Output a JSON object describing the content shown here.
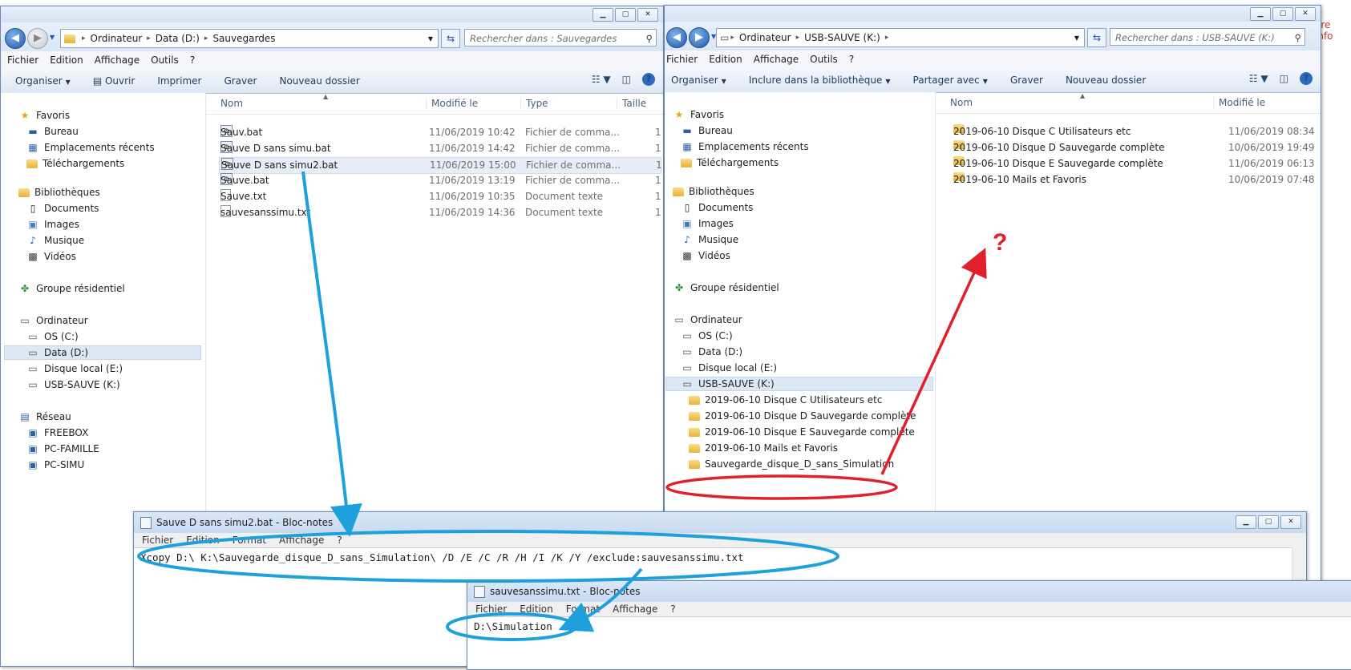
{
  "bg_text": {
    "right": "ore info"
  },
  "left_explorer": {
    "address": [
      "Ordinateur",
      "Data (D:)",
      "Sauvegardes"
    ],
    "search_placeholder": "Rechercher dans : Sauvegardes",
    "menu": [
      "Fichier",
      "Edition",
      "Affichage",
      "Outils",
      "?"
    ],
    "cmd": {
      "organize": "Organiser",
      "open": "Ouvrir",
      "print": "Imprimer",
      "burn": "Graver",
      "new_folder": "Nouveau dossier"
    },
    "columns": {
      "name": "Nom",
      "modified": "Modifié le",
      "type": "Type",
      "size": "Taille"
    },
    "files": [
      {
        "name": "Sauv.bat",
        "date": "11/06/2019 10:42",
        "type": "Fichier de comma...",
        "size": "1"
      },
      {
        "name": "Sauve D sans simu.bat",
        "date": "11/06/2019 14:42",
        "type": "Fichier de comma...",
        "size": "1"
      },
      {
        "name": "Sauve D sans simu2.bat",
        "date": "11/06/2019 15:00",
        "type": "Fichier de comma...",
        "size": "1"
      },
      {
        "name": "Sauve.bat",
        "date": "11/06/2019 13:19",
        "type": "Fichier de comma...",
        "size": "1"
      },
      {
        "name": "Sauve.txt",
        "date": "11/06/2019 10:35",
        "type": "Document texte",
        "size": "1"
      },
      {
        "name": "sauvesanssimu.txt",
        "date": "11/06/2019 14:36",
        "type": "Document texte",
        "size": "1"
      }
    ],
    "nav": {
      "favorites": "Favoris",
      "desktop": "Bureau",
      "recent": "Emplacements récents",
      "downloads": "Téléchargements",
      "libraries": "Bibliothèques",
      "documents": "Documents",
      "images": "Images",
      "music": "Musique",
      "videos": "Vidéos",
      "homegroup": "Groupe résidentiel",
      "computer": "Ordinateur",
      "os": "OS (C:)",
      "data": "Data (D:)",
      "local_e": "Disque local (E:)",
      "usb": "USB-SAUVE (K:)",
      "network": "Réseau",
      "freebox": "FREEBOX",
      "pc_famille": "PC-FAMILLE",
      "pc_simu": "PC-SIMU"
    }
  },
  "right_explorer": {
    "address": [
      "Ordinateur",
      "USB-SAUVE (K:)"
    ],
    "search_placeholder": "Rechercher dans : USB-SAUVE (K:)",
    "menu": [
      "Fichier",
      "Edition",
      "Affichage",
      "Outils",
      "?"
    ],
    "cmd": {
      "organize": "Organiser",
      "include": "Inclure dans la bibliothèque",
      "share": "Partager avec",
      "burn": "Graver",
      "new_folder": "Nouveau dossier"
    },
    "columns": {
      "name": "Nom",
      "modified": "Modifié le"
    },
    "folders": [
      {
        "name": "2019-06-10 Disque C Utilisateurs etc",
        "date": "11/06/2019 08:34"
      },
      {
        "name": "2019-06-10 Disque D Sauvegarde complète",
        "date": "10/06/2019 19:49"
      },
      {
        "name": "2019-06-10 Disque E Sauvegarde complète",
        "date": "11/06/2019 06:13"
      },
      {
        "name": "2019-06-10 Mails et Favoris",
        "date": "10/06/2019 07:48"
      }
    ],
    "nav": {
      "favorites": "Favoris",
      "desktop": "Bureau",
      "recent": "Emplacements récents",
      "downloads": "Téléchargements",
      "libraries": "Bibliothèques",
      "documents": "Documents",
      "images": "Images",
      "music": "Musique",
      "videos": "Vidéos",
      "homegroup": "Groupe résidentiel",
      "computer": "Ordinateur",
      "os": "OS (C:)",
      "data": "Data (D:)",
      "local_e": "Disque local (E:)",
      "usb": "USB-SAUVE (K:)",
      "sub": [
        "2019-06-10 Disque C Utilisateurs etc",
        "2019-06-10 Disque D Sauvegarde complète",
        "2019-06-10 Disque E Sauvegarde complète",
        "2019-06-10 Mails et Favoris",
        "Sauvegarde_disque_D_sans_Simulation"
      ]
    }
  },
  "notepad1": {
    "title": "Sauve D sans simu2.bat - Bloc-notes",
    "menu": [
      "Fichier",
      "Edition",
      "Format",
      "Affichage",
      "?"
    ],
    "content": "Xcopy D:\\ K:\\Sauvegarde_disque_D_sans_Simulation\\ /D /E /C /R /H /I /K /Y /exclude:sauvesanssimu.txt"
  },
  "notepad2": {
    "title": "sauvesanssimu.txt - Bloc-notes",
    "menu": [
      "Fichier",
      "Edition",
      "Format",
      "Affichage",
      "?"
    ],
    "content": "D:\\Simulation"
  },
  "annotation": {
    "question_mark": "?",
    "blue": "#1ea0dc",
    "red": "#e0202a"
  }
}
